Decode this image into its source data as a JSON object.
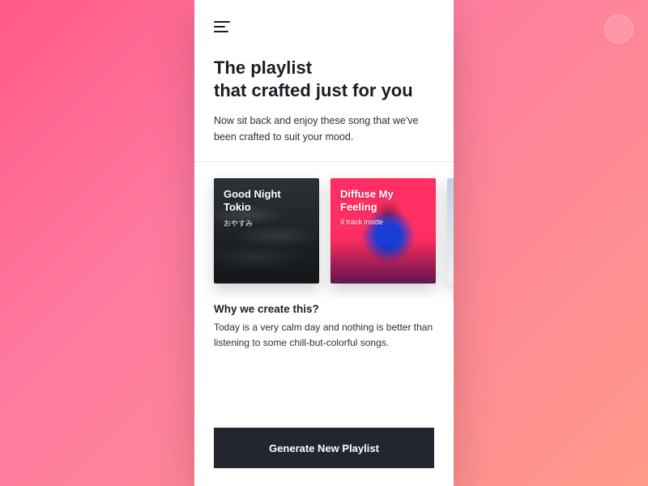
{
  "header": {
    "title": "The playlist\nthat crafted just for you",
    "subtitle": "Now sit back and enjoy these song that we've been crafted to suit your mood."
  },
  "playlists": [
    {
      "title": "Good Night\nTokio",
      "subtitle": "おやすみ"
    },
    {
      "title": "Diffuse My\nFeeling",
      "subtitle": "9 track inside"
    },
    {
      "title": "",
      "subtitle": ""
    }
  ],
  "reason": {
    "heading": "Why we create this?",
    "body": "Today is a very calm day and nothing is better than listening to some chill-but-colorful songs."
  },
  "actions": {
    "generate": "Generate New Playlist"
  }
}
